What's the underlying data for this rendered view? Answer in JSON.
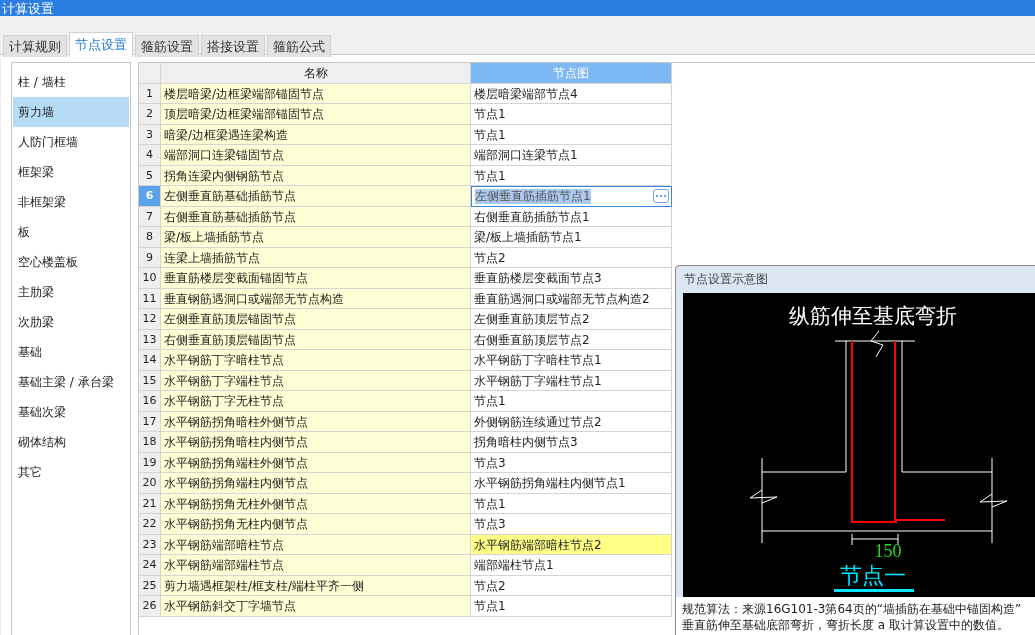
{
  "window": {
    "title": "计算设置"
  },
  "tabs": [
    {
      "label": "计算规则",
      "selected": false
    },
    {
      "label": "节点设置",
      "selected": true
    },
    {
      "label": "箍筋设置",
      "selected": false
    },
    {
      "label": "搭接设置",
      "selected": false
    },
    {
      "label": "箍筋公式",
      "selected": false
    }
  ],
  "sidebar": {
    "items": [
      {
        "label": "柱 / 墙柱",
        "selected": false
      },
      {
        "label": "剪力墙",
        "selected": true
      },
      {
        "label": "人防门框墙",
        "selected": false
      },
      {
        "label": "框架梁",
        "selected": false
      },
      {
        "label": "非框架梁",
        "selected": false
      },
      {
        "label": "板",
        "selected": false
      },
      {
        "label": "空心楼盖板",
        "selected": false
      },
      {
        "label": "主肋梁",
        "selected": false
      },
      {
        "label": "次肋梁",
        "selected": false
      },
      {
        "label": "基础",
        "selected": false
      },
      {
        "label": "基础主梁 / 承台梁",
        "selected": false
      },
      {
        "label": "基础次梁",
        "selected": false
      },
      {
        "label": "砌体结构",
        "selected": false
      },
      {
        "label": "其它",
        "selected": false
      }
    ]
  },
  "table": {
    "columns": [
      {
        "label": "名称",
        "selected": false
      },
      {
        "label": "节点图",
        "selected": true
      }
    ],
    "rows": [
      {
        "index": "1",
        "name": "楼层暗梁/边框梁端部锚固节点",
        "node": "楼层暗梁端部节点4",
        "selected": false,
        "highlighted": false
      },
      {
        "index": "2",
        "name": "顶层暗梁/边框梁端部锚固节点",
        "node": "节点1",
        "selected": false,
        "highlighted": false
      },
      {
        "index": "3",
        "name": "暗梁/边框梁遇连梁构造",
        "node": "节点1",
        "selected": false,
        "highlighted": false
      },
      {
        "index": "4",
        "name": "端部洞口连梁锚固节点",
        "node": "端部洞口连梁节点1",
        "selected": false,
        "highlighted": false
      },
      {
        "index": "5",
        "name": "拐角连梁内侧钢筋节点",
        "node": "节点1",
        "selected": false,
        "highlighted": false
      },
      {
        "index": "6",
        "name": "左侧垂直筋基础插筋节点",
        "node": "左侧垂直筋插筋节点1",
        "selected": true,
        "highlighted": false
      },
      {
        "index": "7",
        "name": "右侧垂直筋基础插筋节点",
        "node": "右侧垂直筋插筋节点1",
        "selected": false,
        "highlighted": false
      },
      {
        "index": "8",
        "name": "梁/板上墙插筋节点",
        "node": "梁/板上墙插筋节点1",
        "selected": false,
        "highlighted": false
      },
      {
        "index": "9",
        "name": "连梁上墙插筋节点",
        "node": "节点2",
        "selected": false,
        "highlighted": false
      },
      {
        "index": "10",
        "name": "垂直筋楼层变截面锚固节点",
        "node": "垂直筋楼层变截面节点3",
        "selected": false,
        "highlighted": false
      },
      {
        "index": "11",
        "name": "垂直钢筋遇洞口或端部无节点构造",
        "node": "垂直筋遇洞口或端部无节点构造2",
        "selected": false,
        "highlighted": false
      },
      {
        "index": "12",
        "name": "左侧垂直筋顶层锚固节点",
        "node": "左侧垂直筋顶层节点2",
        "selected": false,
        "highlighted": false
      },
      {
        "index": "13",
        "name": "右侧垂直筋顶层锚固节点",
        "node": "右侧垂直筋顶层节点2",
        "selected": false,
        "highlighted": false
      },
      {
        "index": "14",
        "name": "水平钢筋丁字暗柱节点",
        "node": "水平钢筋丁字暗柱节点1",
        "selected": false,
        "highlighted": false
      },
      {
        "index": "15",
        "name": "水平钢筋丁字端柱节点",
        "node": "水平钢筋丁字端柱节点1",
        "selected": false,
        "highlighted": false
      },
      {
        "index": "16",
        "name": "水平钢筋丁字无柱节点",
        "node": "节点1",
        "selected": false,
        "highlighted": false
      },
      {
        "index": "17",
        "name": "水平钢筋拐角暗柱外侧节点",
        "node": "外侧钢筋连续通过节点2",
        "selected": false,
        "highlighted": false
      },
      {
        "index": "18",
        "name": "水平钢筋拐角暗柱内侧节点",
        "node": "拐角暗柱内侧节点3",
        "selected": false,
        "highlighted": false
      },
      {
        "index": "19",
        "name": "水平钢筋拐角端柱外侧节点",
        "node": "节点3",
        "selected": false,
        "highlighted": false
      },
      {
        "index": "20",
        "name": "水平钢筋拐角端柱内侧节点",
        "node": "水平钢筋拐角端柱内侧节点1",
        "selected": false,
        "highlighted": false
      },
      {
        "index": "21",
        "name": "水平钢筋拐角无柱外侧节点",
        "node": "节点1",
        "selected": false,
        "highlighted": false
      },
      {
        "index": "22",
        "name": "水平钢筋拐角无柱内侧节点",
        "node": "节点3",
        "selected": false,
        "highlighted": false
      },
      {
        "index": "23",
        "name": "水平钢筋端部暗柱节点",
        "node": "水平钢筋端部暗柱节点2",
        "selected": false,
        "highlighted": true
      },
      {
        "index": "24",
        "name": "水平钢筋端部端柱节点",
        "node": "端部端柱节点1",
        "selected": false,
        "highlighted": false
      },
      {
        "index": "25",
        "name": "剪力墙遇框架柱/框支柱/端柱平齐一侧",
        "node": "节点2",
        "selected": false,
        "highlighted": false
      },
      {
        "index": "26",
        "name": "水平钢筋斜交丁字墙节点",
        "node": "节点1",
        "selected": false,
        "highlighted": false
      }
    ]
  },
  "preview": {
    "title": "节点设置示意图",
    "heading": "纵筋伸至基底弯折",
    "dimension": "150",
    "caption": "节点一",
    "description": [
      "规范算法：来源16G101-3第64页的“墙插筋在基础中锚固构造”",
      "垂直筋伸至基础底部弯折，弯折长度 a 取计算设置中的数值。"
    ]
  }
}
